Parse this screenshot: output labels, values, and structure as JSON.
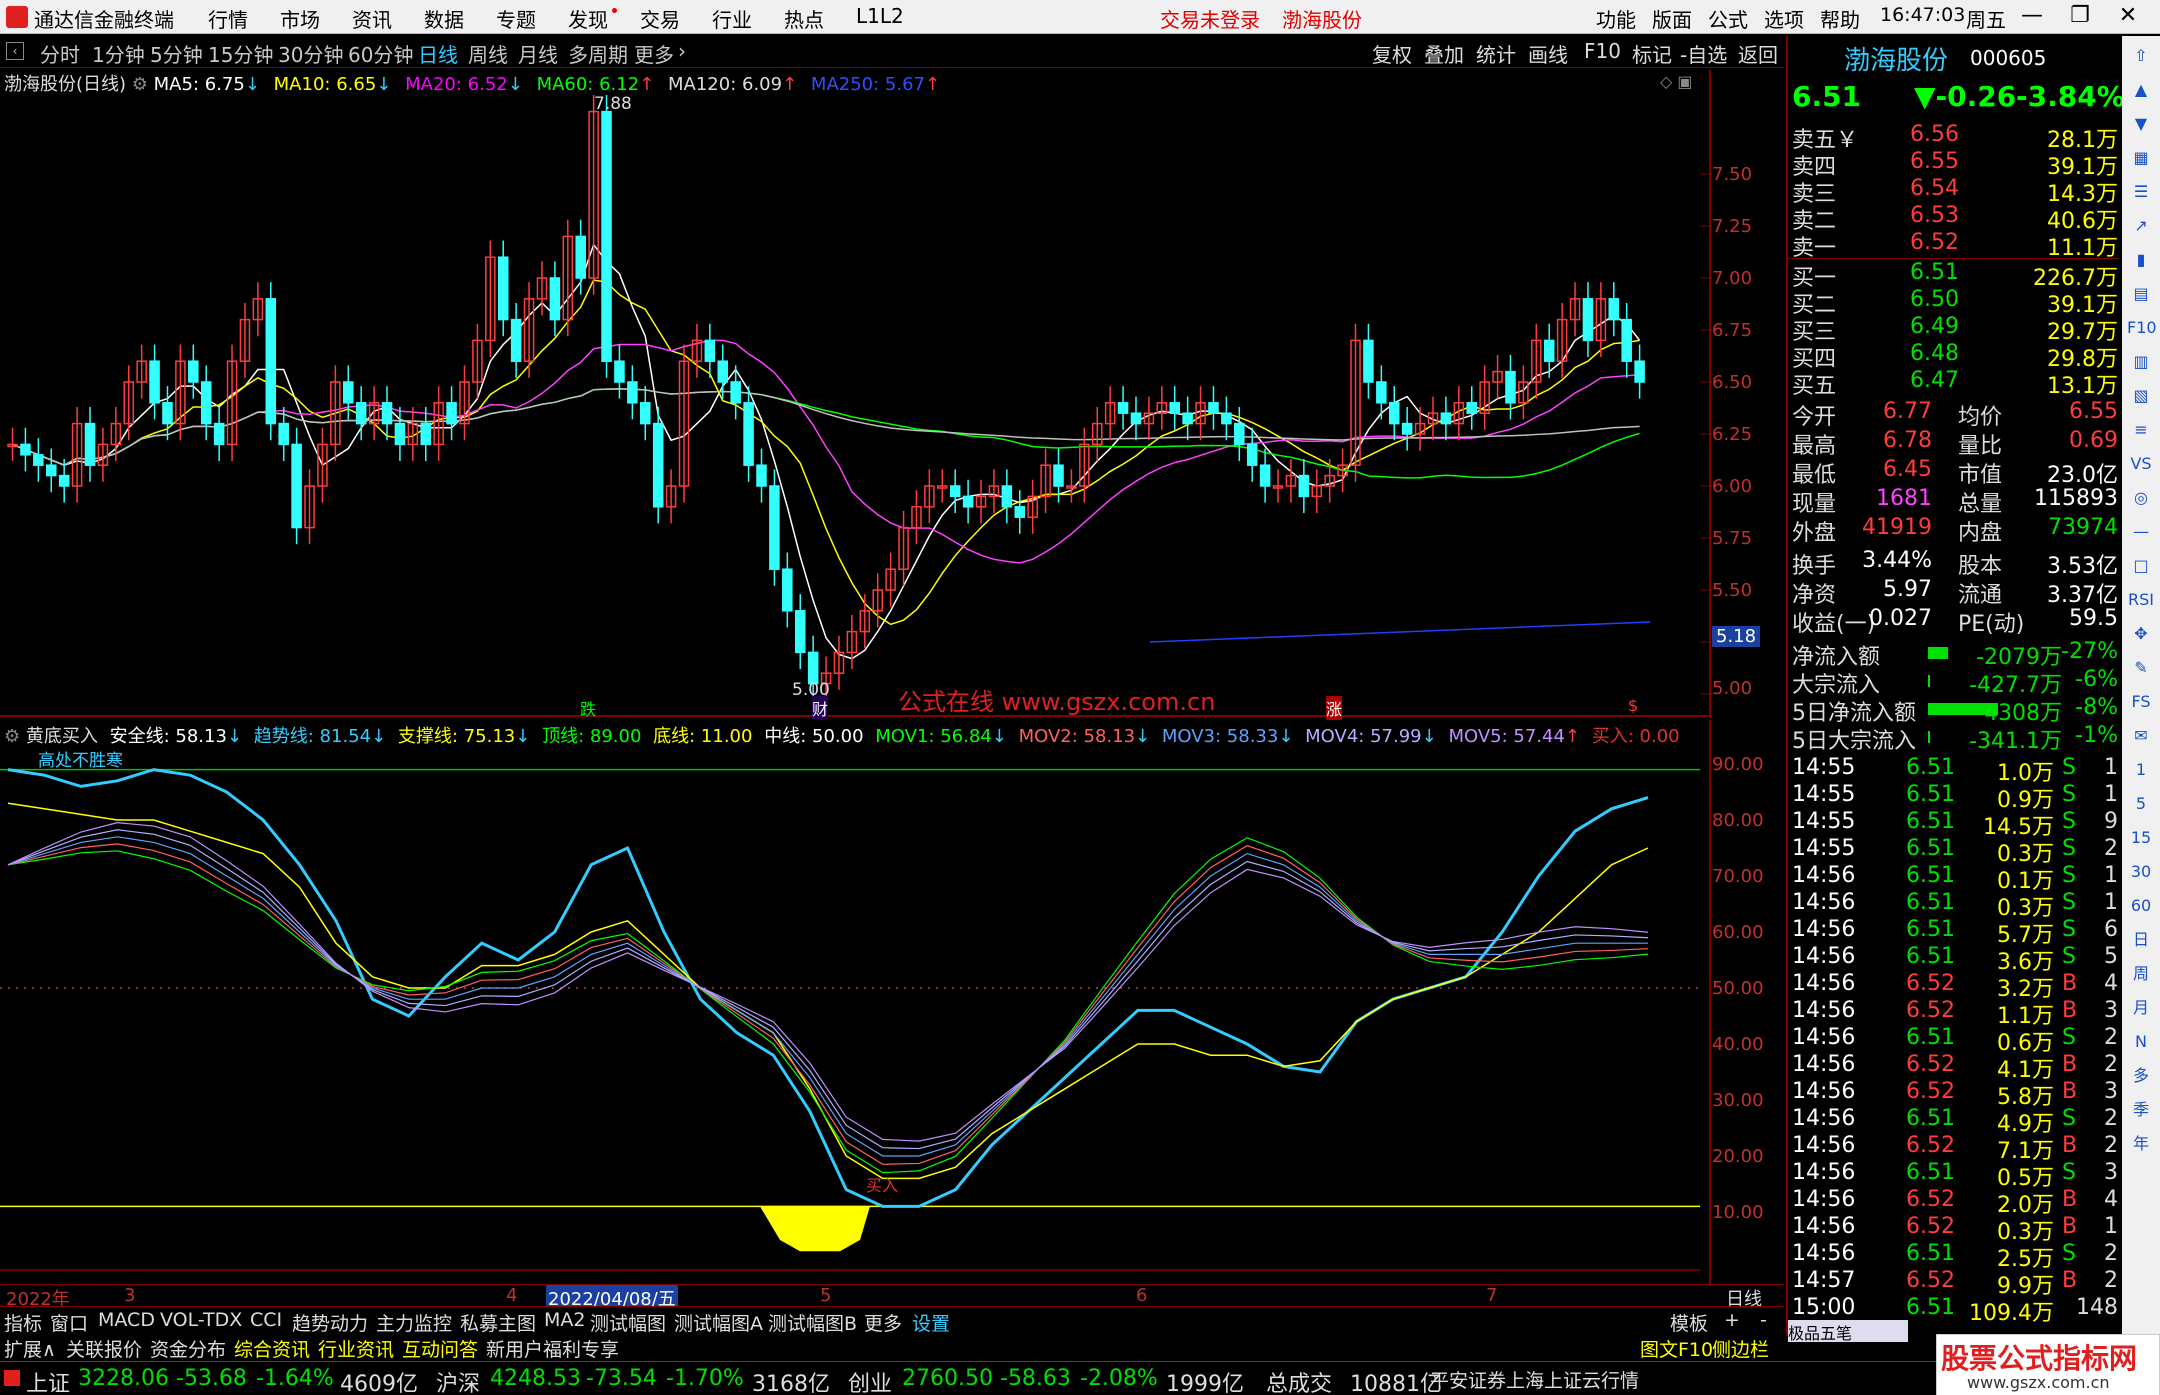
{
  "app": {
    "title": "通达信金融终端",
    "menu": [
      "行情",
      "市场",
      "资讯",
      "数据",
      "专题",
      "发现",
      "交易",
      "行业",
      "热点",
      "L1L2"
    ],
    "warn_login": "交易未登录",
    "stock_header": "渤海股份",
    "right_menu": [
      "功能",
      "版面",
      "公式",
      "选项",
      "帮助"
    ],
    "time": "16:47:03",
    "weekday": "周五"
  },
  "periods": [
    "分时",
    "1分钟",
    "5分钟",
    "15分钟",
    "30分钟",
    "60分钟",
    "日线",
    "周线",
    "月线",
    "多周期",
    "更多"
  ],
  "active_period": "日线",
  "tools": [
    "复权",
    "叠加",
    "统计",
    "画线",
    "F10",
    "标记",
    "-自选",
    "返回"
  ],
  "main_legend": {
    "name": "渤海股份(日线)",
    "ma5": "MA5: 6.75",
    "ma10": "MA10: 6.65",
    "ma20": "MA20: 6.52",
    "ma60": "MA60: 6.12",
    "ma120": "MA120: 6.09",
    "ma250": "MA250: 5.67"
  },
  "price_axis": [
    "7.50",
    "7.25",
    "7.00",
    "6.75",
    "6.50",
    "6.25",
    "6.00",
    "5.75",
    "5.50",
    "5.18",
    "5.00"
  ],
  "annotations": {
    "high": "7.88",
    "low": "5.00",
    "watermark": "公式在线 www.gszx.com.cn",
    "m1": "跌",
    "m2": "财",
    "m3": "涨",
    "m4": "$"
  },
  "ind_legend": {
    "name": "黄底买入",
    "safe": "安全线: 58.13",
    "trend": "趋势线: 81.54",
    "support": "支撑线: 75.13",
    "top": "顶线: 89.00",
    "bottom": "底线: 11.00",
    "mid": "中线: 50.00",
    "mov1": "MOV1: 56.84",
    "mov2": "MOV2: 58.13",
    "mov3": "MOV3: 58.33",
    "mov4": "MOV4: 57.99",
    "mov5": "MOV5: 57.44",
    "buy": "买入: 0.00",
    "note": "高处不胜寒",
    "buy_mark": "买入"
  },
  "ind_axis": [
    "90.00",
    "80.00",
    "70.00",
    "60.00",
    "50.00",
    "40.00",
    "30.00",
    "20.00",
    "10.00"
  ],
  "date_axis": {
    "year": "2022年",
    "m3": "3",
    "m4": "4",
    "cursor": "2022/04/08/五",
    "m5": "5",
    "m6": "6",
    "m7": "7",
    "period_label": "日线"
  },
  "quote": {
    "name": "渤海股份",
    "code": "000605",
    "price": "6.51",
    "change": "▼-0.26",
    "pct": "-3.84%",
    "asks": [
      {
        "label": "卖五",
        "flag": "￥",
        "price": "6.56",
        "vol": "28.1万"
      },
      {
        "label": "卖四",
        "flag": "",
        "price": "6.55",
        "vol": "39.1万"
      },
      {
        "label": "卖三",
        "flag": "",
        "price": "6.54",
        "vol": "14.3万"
      },
      {
        "label": "卖二",
        "flag": "",
        "price": "6.53",
        "vol": "40.6万"
      },
      {
        "label": "卖一",
        "flag": "",
        "price": "6.52",
        "vol": "11.1万"
      }
    ],
    "bids": [
      {
        "label": "买一",
        "price": "6.51",
        "vol": "226.7万"
      },
      {
        "label": "买二",
        "price": "6.50",
        "vol": "39.1万"
      },
      {
        "label": "买三",
        "price": "6.49",
        "vol": "29.7万"
      },
      {
        "label": "买四",
        "price": "6.48",
        "vol": "29.8万"
      },
      {
        "label": "买五",
        "price": "6.47",
        "vol": "13.1万"
      }
    ],
    "stats1": [
      [
        "今开",
        "6.77",
        "均价",
        "6.55"
      ],
      [
        "最高",
        "6.78",
        "量比",
        "0.69"
      ],
      [
        "最低",
        "6.45",
        "市值",
        "23.0亿"
      ],
      [
        "现量",
        "1681",
        "总量",
        "115893"
      ],
      [
        "外盘",
        "41919",
        "内盘",
        "73974"
      ]
    ],
    "stats2": [
      [
        "换手",
        "3.44%",
        "股本",
        "3.53亿"
      ],
      [
        "净资",
        "5.97",
        "流通",
        "3.37亿"
      ],
      [
        "收益(一)",
        "0.027",
        "PE(动)",
        "59.5"
      ]
    ],
    "flows": [
      {
        "label": "净流入额",
        "val": "-2079万",
        "pct": "-27%"
      },
      {
        "label": "大宗流入",
        "val": "-427.7万",
        "pct": "-6%"
      },
      {
        "label": "5日净流入额",
        "val": "-4308万",
        "pct": "-8%"
      },
      {
        "label": "5日大宗流入",
        "val": "-341.1万",
        "pct": "-1%"
      }
    ],
    "ticks": [
      [
        "14:55",
        "6.51",
        "1.0万",
        "S",
        "1"
      ],
      [
        "14:55",
        "6.51",
        "0.9万",
        "S",
        "1"
      ],
      [
        "14:55",
        "6.51",
        "14.5万",
        "S",
        "9"
      ],
      [
        "14:55",
        "6.51",
        "0.3万",
        "S",
        "2"
      ],
      [
        "14:56",
        "6.51",
        "0.1万",
        "S",
        "1"
      ],
      [
        "14:56",
        "6.51",
        "0.3万",
        "S",
        "1"
      ],
      [
        "14:56",
        "6.51",
        "5.7万",
        "S",
        "6"
      ],
      [
        "14:56",
        "6.51",
        "3.6万",
        "S",
        "5"
      ],
      [
        "14:56",
        "6.52",
        "3.2万",
        "B",
        "4"
      ],
      [
        "14:56",
        "6.52",
        "1.1万",
        "B",
        "3"
      ],
      [
        "14:56",
        "6.51",
        "0.6万",
        "S",
        "2"
      ],
      [
        "14:56",
        "6.52",
        "4.1万",
        "B",
        "2"
      ],
      [
        "14:56",
        "6.52",
        "5.8万",
        "B",
        "3"
      ],
      [
        "14:56",
        "6.51",
        "4.9万",
        "S",
        "2"
      ],
      [
        "14:56",
        "6.52",
        "7.1万",
        "B",
        "2"
      ],
      [
        "14:56",
        "6.51",
        "0.5万",
        "S",
        "3"
      ],
      [
        "14:56",
        "6.52",
        "2.0万",
        "B",
        "4"
      ],
      [
        "14:56",
        "6.52",
        "0.3万",
        "B",
        "1"
      ],
      [
        "14:56",
        "6.51",
        "2.5万",
        "S",
        "2"
      ],
      [
        "14:57",
        "6.52",
        "9.9万",
        "B",
        "2"
      ],
      [
        "15:00",
        "6.51",
        "109.4万",
        "",
        "148"
      ]
    ]
  },
  "side_icons": [
    "up-arrow",
    "arrow-up",
    "arrow-down",
    "chart",
    "list",
    "trend",
    "candle",
    "grid",
    "f10",
    "chart2",
    "grid2",
    "list2",
    "vs",
    "circle",
    "minus",
    "box",
    "rsi",
    "move",
    "pen",
    "fs",
    "chat",
    "1",
    "5",
    "15",
    "30",
    "60",
    "日",
    "周",
    "月",
    "N",
    "多",
    "季",
    "年"
  ],
  "bottom_tabs": [
    "指标",
    "窗口",
    "MACD",
    "VOL-TDX",
    "CCI",
    "趋势动力",
    "主力监控",
    "私募主图",
    "MA2",
    "测试幅图",
    "测试幅图A",
    "测试幅图B",
    "更多",
    "设置"
  ],
  "bottom_tabs_right": [
    "模板",
    "+",
    "-"
  ],
  "bottom_tabs2": [
    "扩展∧",
    "关联报价",
    "资金分布",
    "综合资讯",
    "行业资讯",
    "互动问答",
    "新用户福利专享"
  ],
  "bottom_right2": [
    "图文F10",
    "侧边栏"
  ],
  "toolbar_floating": "极品五笔",
  "status": {
    "sh_name": "上证",
    "sh_val": "3228.06",
    "sh_chg": "-53.68",
    "sh_pct": "-1.64%",
    "sh_amt": "4609亿",
    "hs_name": "沪深",
    "hs_val": "4248.53",
    "hs_chg": "-73.54",
    "hs_pct": "-1.70%",
    "hs_amt": "3168亿",
    "cy_name": "创业",
    "cy_val": "2760.50",
    "cy_chg": "-58.63",
    "cy_pct": "-2.08%",
    "cy_amt": "1999亿",
    "total_label": "总成交",
    "total_val": "10881亿",
    "broker": "平安证券上海上证云行情",
    "brand": "股票公式指标网",
    "brand_url": "www.gszx.com.cn"
  }
}
